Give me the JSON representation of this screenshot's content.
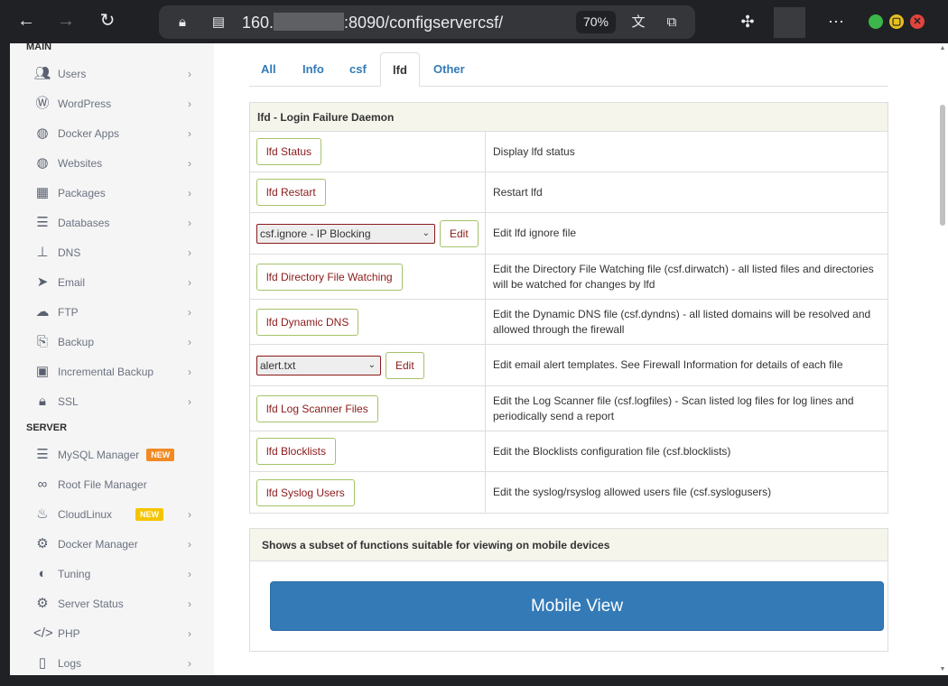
{
  "browser": {
    "url_prefix": "160.",
    "url_suffix": ":8090/configservercsf/",
    "zoom": "70%",
    "back_icon": "arrow-left-icon",
    "forward_icon": "arrow-right-icon",
    "reload_icon": "reload-icon"
  },
  "sidebar": {
    "main_heading": "MAIN",
    "server_heading": "SERVER",
    "main_items": [
      {
        "label": "Users",
        "icon": "users-icon"
      },
      {
        "label": "WordPress",
        "icon": "wordpress-icon"
      },
      {
        "label": "Docker Apps",
        "icon": "globe-icon"
      },
      {
        "label": "Websites",
        "icon": "globe-icon"
      },
      {
        "label": "Packages",
        "icon": "cubes-icon"
      },
      {
        "label": "Databases",
        "icon": "database-icon"
      },
      {
        "label": "DNS",
        "icon": "sitemap-icon"
      },
      {
        "label": "Email",
        "icon": "paper-plane-icon"
      },
      {
        "label": "FTP",
        "icon": "cloud-upload-icon"
      },
      {
        "label": "Backup",
        "icon": "copy-icon"
      },
      {
        "label": "Incremental Backup",
        "icon": "save-icon"
      },
      {
        "label": "SSL",
        "icon": "lock-icon"
      }
    ],
    "server_items": [
      {
        "label": "MySQL Manager",
        "icon": "database-icon",
        "badge": "NEW"
      },
      {
        "label": "Root File Manager",
        "icon": "link-icon"
      },
      {
        "label": "CloudLinux",
        "icon": "fire-icon",
        "badge": "NEW"
      },
      {
        "label": "Docker Manager",
        "icon": "cogs-icon"
      },
      {
        "label": "Tuning",
        "icon": "adjust-icon"
      },
      {
        "label": "Server Status",
        "icon": "gear-icon"
      },
      {
        "label": "PHP",
        "icon": "code-icon"
      },
      {
        "label": "Logs",
        "icon": "file-icon"
      }
    ]
  },
  "tabs": [
    "All",
    "Info",
    "csf",
    "lfd",
    "Other"
  ],
  "active_tab": "lfd",
  "lfd_panel": {
    "title": "lfd - Login Failure Daemon",
    "rows": [
      {
        "button": "lfd Status",
        "desc": "Display lfd status"
      },
      {
        "button": "lfd Restart",
        "desc": "Restart lfd"
      },
      {
        "select": "csf.ignore - IP Blocking",
        "button": "Edit",
        "desc": "Edit lfd ignore file"
      },
      {
        "button": "lfd Directory File Watching",
        "desc": "Edit the Directory File Watching file (csf.dirwatch) - all listed files and directories will be watched for changes by lfd"
      },
      {
        "button": "lfd Dynamic DNS",
        "desc": "Edit the Dynamic DNS file (csf.dyndns) - all listed domains will be resolved and allowed through the firewall"
      },
      {
        "select": "alert.txt",
        "button": "Edit",
        "desc": "Edit email alert templates. See Firewall Information for details of each file"
      },
      {
        "button": "lfd Log Scanner Files",
        "desc": "Edit the Log Scanner file (csf.logfiles) - Scan listed log files for log lines and periodically send a report"
      },
      {
        "button": "lfd Blocklists",
        "desc": "Edit the Blocklists configuration file (csf.blocklists)"
      },
      {
        "button": "lfd Syslog Users",
        "desc": "Edit the syslog/rsyslog allowed users file (csf.syslogusers)"
      }
    ]
  },
  "mobile_panel": {
    "title": "Shows a subset of functions suitable for viewing on mobile devices",
    "button": "Mobile View"
  },
  "colors": {
    "link_blue": "#337ab7",
    "button_text": "#8b1a1a",
    "button_border": "#a6c26a",
    "badge_orange": "#f08a24",
    "badge_yellow": "#f5c400"
  }
}
